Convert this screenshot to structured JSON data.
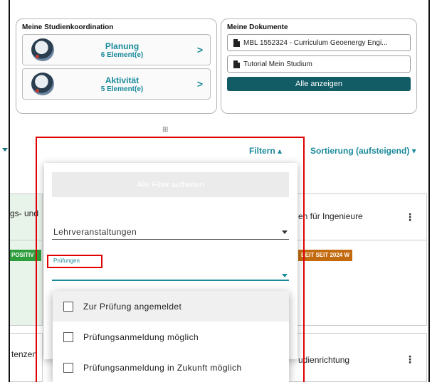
{
  "studienkoordination": {
    "title": "Meine Studienkoordination",
    "items": [
      {
        "name": "Planung",
        "count": "6 Element(e)",
        "chevron": ">"
      },
      {
        "name": "Aktivität",
        "count": "5 Element(e)",
        "chevron": ">"
      }
    ]
  },
  "dokumente": {
    "title": "Meine Dokumente",
    "items": [
      {
        "label": "MBL 1552324 - Curriculum Geoenergy Engi..."
      },
      {
        "label": "Tutorial Mein Studium"
      }
    ],
    "all_label": "Alle anzeigen"
  },
  "toolbar": {
    "grid_icon": "⊞",
    "filter_label": "Filtern ▴",
    "sort_label": "Sortierung (aufsteigend) ▾"
  },
  "background_cards": {
    "left_1_header": "gs- und",
    "left_1_badge": "POSITIV",
    "left_2_header": "tenzen",
    "right_1_header": "en für Ingenieure",
    "right_1_badge": "BEIT SEIT 2024 W",
    "right_2_header": "udienrichtung",
    "menu_icon": "⋮"
  },
  "filter_panel": {
    "reset_label": "Alle Filter aufheben",
    "lehrveranstaltungen_label": "Lehrveranstaltungen",
    "pruefungen_label": "Prüfungen"
  },
  "pruefungen_options": [
    {
      "label": "Zur Prüfung angemeldet",
      "checked": false
    },
    {
      "label": "Prüfungsanmeldung möglich",
      "checked": false
    },
    {
      "label": "Prüfungsanmeldung in Zukunft möglich",
      "checked": false
    }
  ],
  "colors": {
    "accent": "#1a8a9a",
    "dark_teal": "#125c66",
    "highlight_red": "#e00000",
    "positive_green": "#2e9e3c",
    "badge_orange": "#c46a0e"
  }
}
